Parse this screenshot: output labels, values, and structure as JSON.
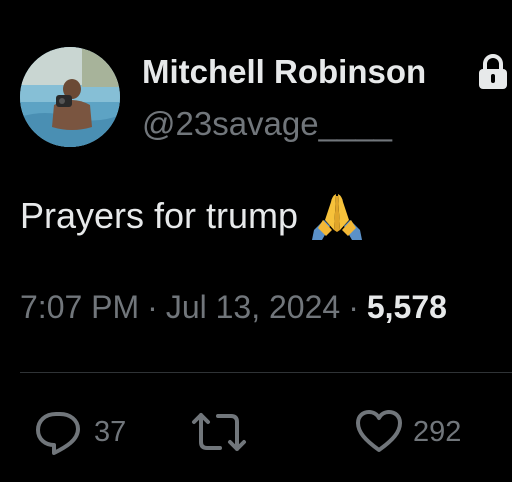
{
  "author": {
    "display_name": "Mitchell Robinson",
    "handle": "@23savage____",
    "protected_icon": "lock-icon"
  },
  "tweet": {
    "text": "Prayers for trump",
    "emoji": "folded-hands-emoji"
  },
  "meta": {
    "time": "7:07 PM",
    "separator": "·",
    "date": "Jul 13, 2024",
    "views": "5,578"
  },
  "actions": {
    "reply_count": "37",
    "like_count": "292",
    "reply_icon": "reply-icon",
    "retweet_icon": "retweet-icon",
    "like_icon": "heart-icon"
  },
  "colors": {
    "background": "#000000",
    "primary_text": "#e7e9ea",
    "secondary_text": "#71767b",
    "divider": "#2f3336"
  }
}
